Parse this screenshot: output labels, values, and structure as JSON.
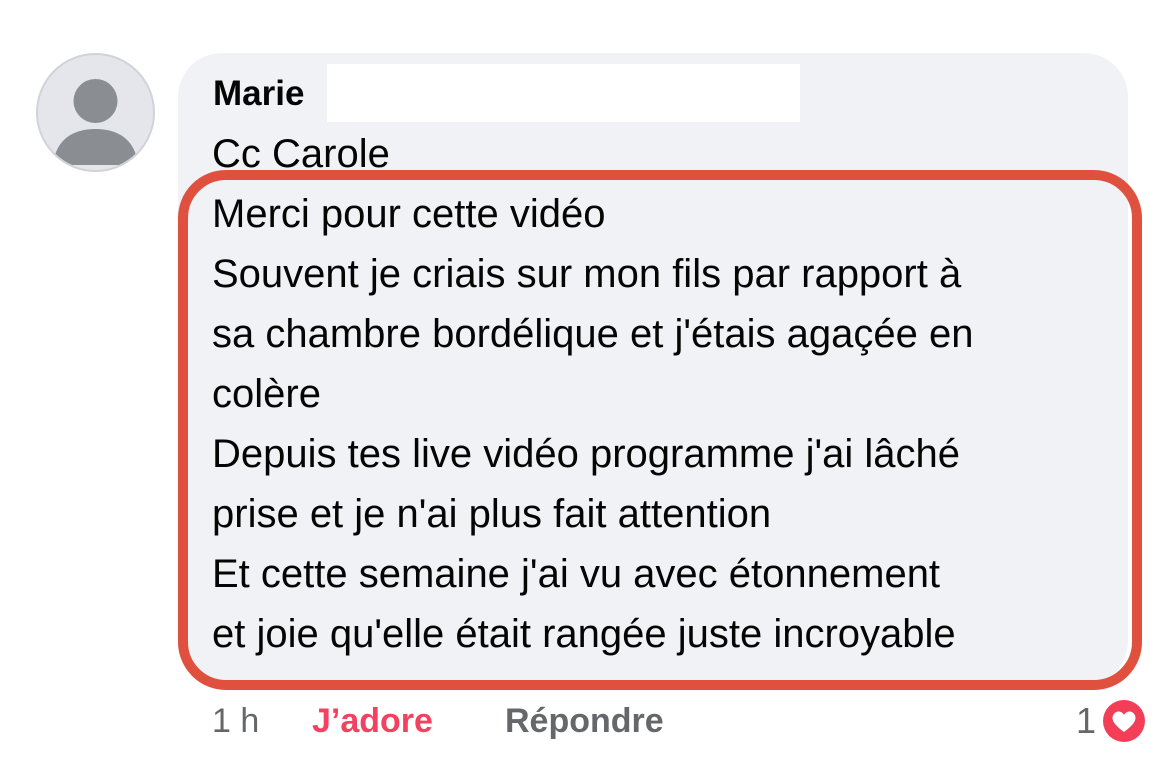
{
  "comment": {
    "author": "Marie",
    "lines": [
      "Cc Carole",
      "Merci pour cette vidéo",
      "Souvent je criais sur mon fils par rapport à",
      "sa chambre bordélique et j'étais agaçée en",
      "colère",
      "Depuis tes live vidéo programme j'ai lâché",
      "prise et je n'ai plus fait attention",
      "Et cette semaine j'ai vu avec étonnement",
      "et joie qu'elle était rangée  juste incroyable"
    ],
    "timestamp": "1 h",
    "reaction_label": "J’adore",
    "reply_label": "Répondre",
    "reaction_count": "1",
    "reaction_icon": "heart-icon"
  },
  "colors": {
    "bubble_bg": "#f0f2f5",
    "highlight_border": "#e0503f",
    "love": "#f3425f",
    "muted": "#65676b"
  }
}
